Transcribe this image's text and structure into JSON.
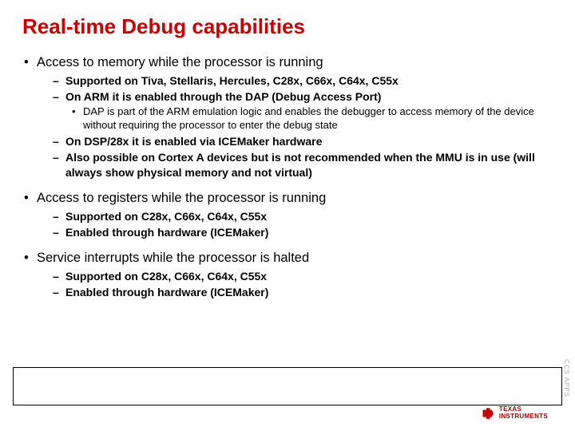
{
  "title": "Real-time Debug capabilities",
  "bullets": {
    "b1_1": "Access to memory while the processor is running",
    "b2_1_1": "Supported on Tiva, Stellaris, Hercules, C28x, C66x, C64x, C55x",
    "b2_1_2": "On ARM it is enabled through the DAP (Debug Access Port)",
    "b3_1_2_1": "DAP is part of the ARM emulation logic and enables the debugger to access memory of the device without requiring the processor to enter the debug state",
    "b2_1_3": "On DSP/28x it is enabled via ICEMaker hardware",
    "b2_1_4": "Also possible on Cortex A devices but is not recommended when the MMU is in use (will always show physical memory and not virtual)",
    "b1_2": "Access to registers while the processor is running",
    "b2_2_1": "Supported on C28x, C66x, C64x, C55x",
    "b2_2_2": "Enabled through hardware (ICEMaker)",
    "b1_3": "Service interrupts while the processor is halted",
    "b2_3_1": "Supported on C28x, C66x, C64x, C55x",
    "b2_3_2": "Enabled through hardware (ICEMaker)"
  },
  "logo": {
    "line1": "TEXAS",
    "line2": "INSTRUMENTS"
  },
  "side": "CCS APPS"
}
